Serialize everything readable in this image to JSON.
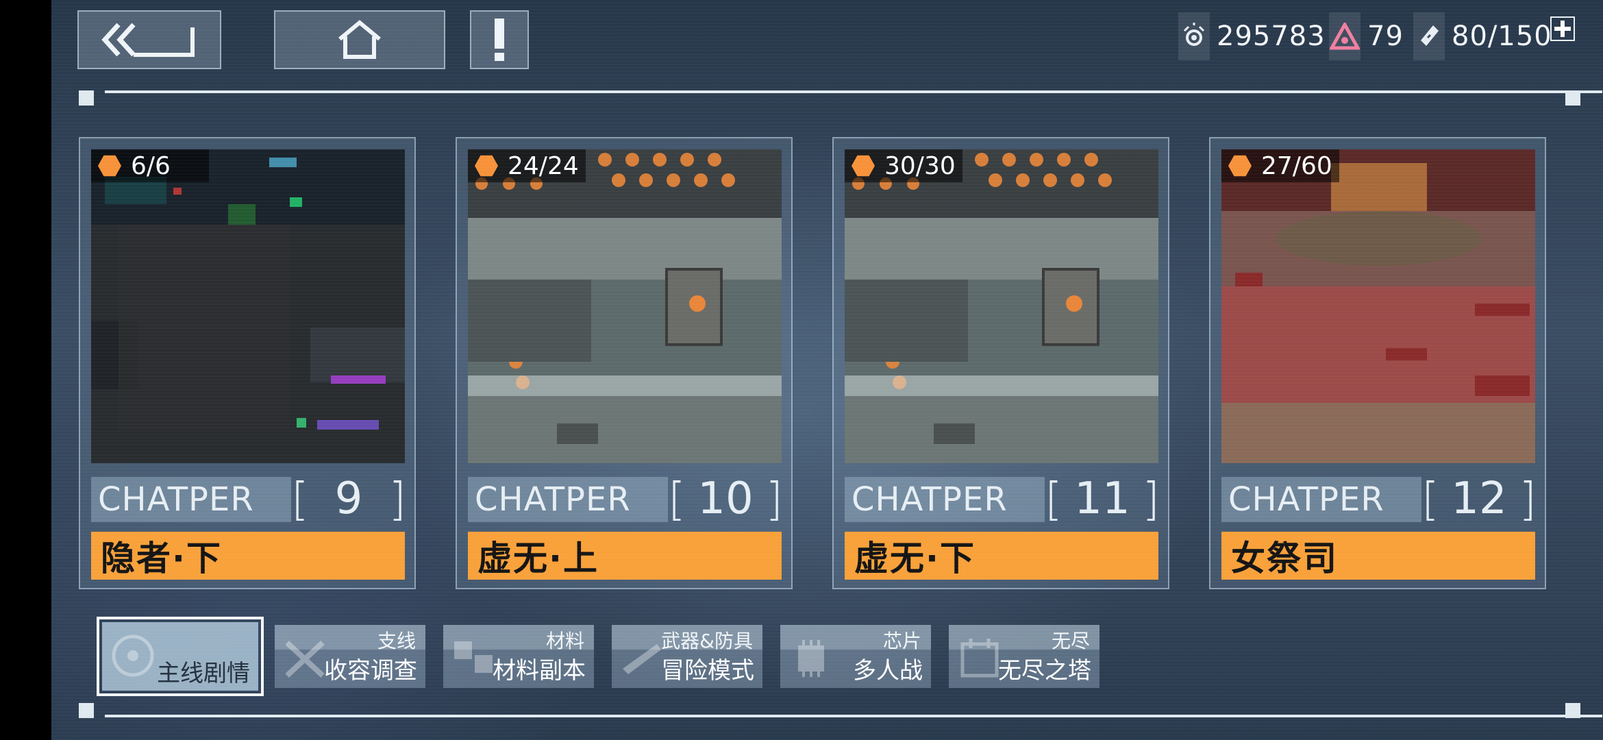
{
  "header": {
    "back_icon": "double-chevron-left-icon",
    "home_icon": "home-icon",
    "alert_icon": "exclamation-icon"
  },
  "currencies": [
    {
      "icon": "eye-orb-icon",
      "value": "295783"
    },
    {
      "icon": "warning-triangle-icon",
      "value": "79"
    },
    {
      "icon": "energy-ticket-icon",
      "value": "80/150"
    }
  ],
  "add_icon": "plus-icon",
  "chapters": [
    {
      "label": "CHATPER",
      "number": "9",
      "title": "隐者·下",
      "progress": "6/6",
      "scene": "dark"
    },
    {
      "label": "CHATPER",
      "number": "10",
      "title": "虚无·上",
      "progress": "24/24",
      "scene": "factory"
    },
    {
      "label": "CHATPER",
      "number": "11",
      "title": "虚无·下",
      "progress": "30/30",
      "scene": "factory"
    },
    {
      "label": "CHATPER",
      "number": "12",
      "title": "女祭司",
      "progress": "27/60",
      "scene": "red"
    }
  ],
  "tabs": [
    {
      "top": "",
      "bottom": "主线剧情",
      "active": true
    },
    {
      "top": "支线",
      "bottom": "收容调查",
      "active": false
    },
    {
      "top": "材料",
      "bottom": "材料副本",
      "active": false
    },
    {
      "top": "武器&防具",
      "bottom": "冒险模式",
      "active": false
    },
    {
      "top": "芯片",
      "bottom": "多人战",
      "active": false
    },
    {
      "top": "无尽",
      "bottom": "无尽之塔",
      "active": false
    }
  ],
  "colors": {
    "accent": "#f9a13a",
    "progress_hex": "#f7923a"
  }
}
